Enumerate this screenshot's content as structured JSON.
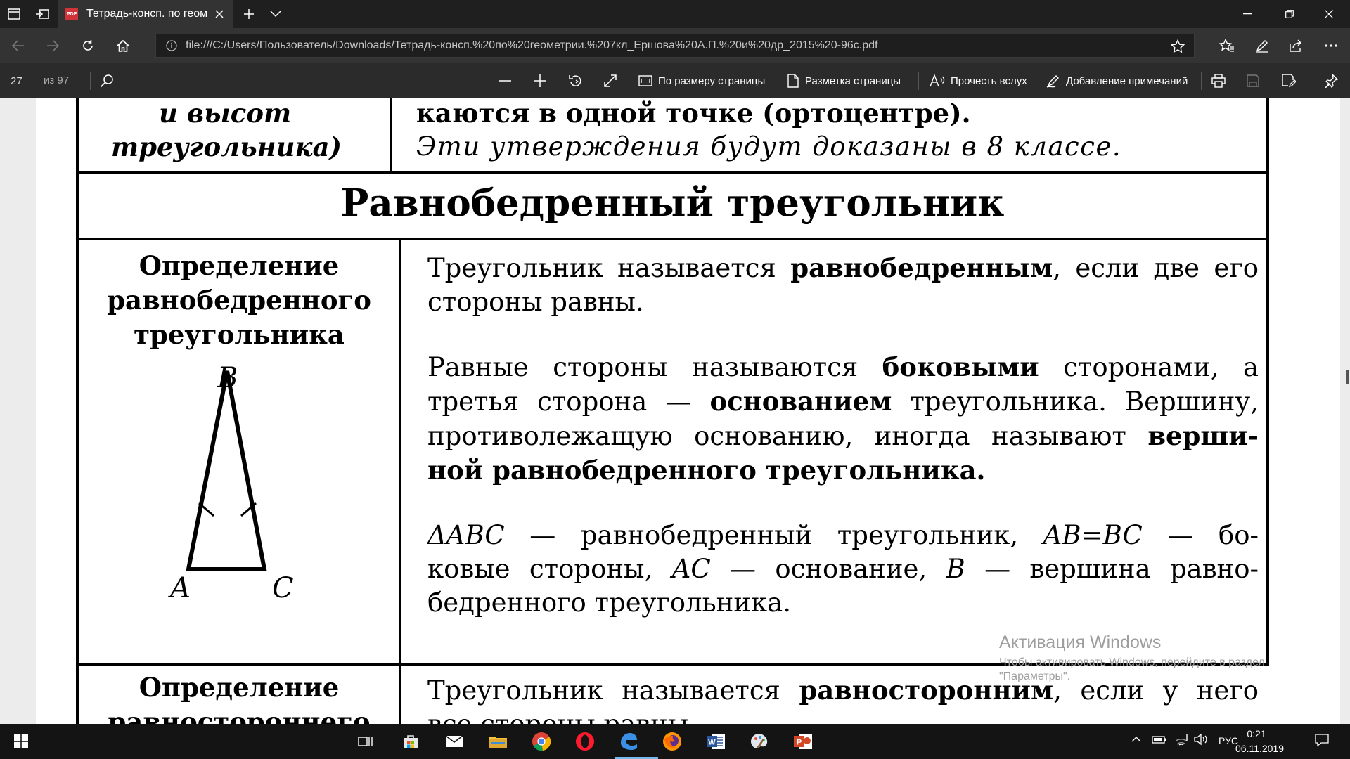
{
  "browser": {
    "tab_title": "Тетрадь-консп. по геом",
    "tab_icon_text": "PDF",
    "url": "file:///C:/Users/Пользователь/Downloads/Тетрадь-консп.%20по%20геометрии.%207кл_Ершова%20А.П.%20и%20др_2015%20-96с.pdf"
  },
  "pdf_toolbar": {
    "page_number": "27",
    "page_total": "из 97",
    "fit_page": "По размеру страницы",
    "page_layout": "Разметка страницы",
    "read_aloud": "Прочесть вслух",
    "add_notes": "Добавление примечаний"
  },
  "document": {
    "top_left_line1": "и высот",
    "top_left_line2": "треугольника)",
    "top_right_line1": "каются в одной точке (ортоцентре).",
    "top_right_line2": "Эти утверждения будут доказаны в 8 классе.",
    "section_title": "Равнобедренный треугольник",
    "def1_label_line1": "Определение",
    "def1_label_line2": "равнобедренного",
    "def1_label_line3": "треугольника",
    "vertex_b": "B",
    "vertex_a": "A",
    "vertex_c": "C",
    "p1_a": "Треугольник называется",
    "p1_b": "равнобедренным",
    "p1_c": ", если две его",
    "p1_d": "стороны равны.",
    "p2_l1a": "Равные стороны называются",
    "p2_l1b": "боковыми",
    "p2_l1c": "сторонами, а",
    "p2_l2a": "третья сторона —",
    "p2_l2b": "основанием",
    "p2_l2c": "треугольника. Вершину,",
    "p2_l3a": "противолежащую основанию, иногда называют",
    "p2_l3b": "верши-",
    "p2_l4": "ной равнобедренного треугольника.",
    "p3_l1a": "ΔABC",
    "p3_l1b": "— равнобедренный треугольник,",
    "p3_l1c": "AB=BC",
    "p3_l1d": "— бо-",
    "p3_l2a": "ковые стороны,",
    "p3_l2b": "AC",
    "p3_l2c": "— основание,",
    "p3_l2d": "B",
    "p3_l2e": "— вершина равно-",
    "p3_l3": "бедренного треугольника.",
    "def2_label_line1": "Определение",
    "def2_label_line2": "равностороннего",
    "p4_a": "Треугольник называется",
    "p4_b": "равносторонним",
    "p4_c": ", если у него",
    "p4_d": "все стороны равны."
  },
  "watermark": {
    "title": "Активация Windows",
    "subtitle": "Чтобы активировать Windows, перейдите в раздел \"Параметры\"."
  },
  "taskbar": {
    "language": "РУС",
    "time": "0:21",
    "date": "06.11.2019"
  }
}
